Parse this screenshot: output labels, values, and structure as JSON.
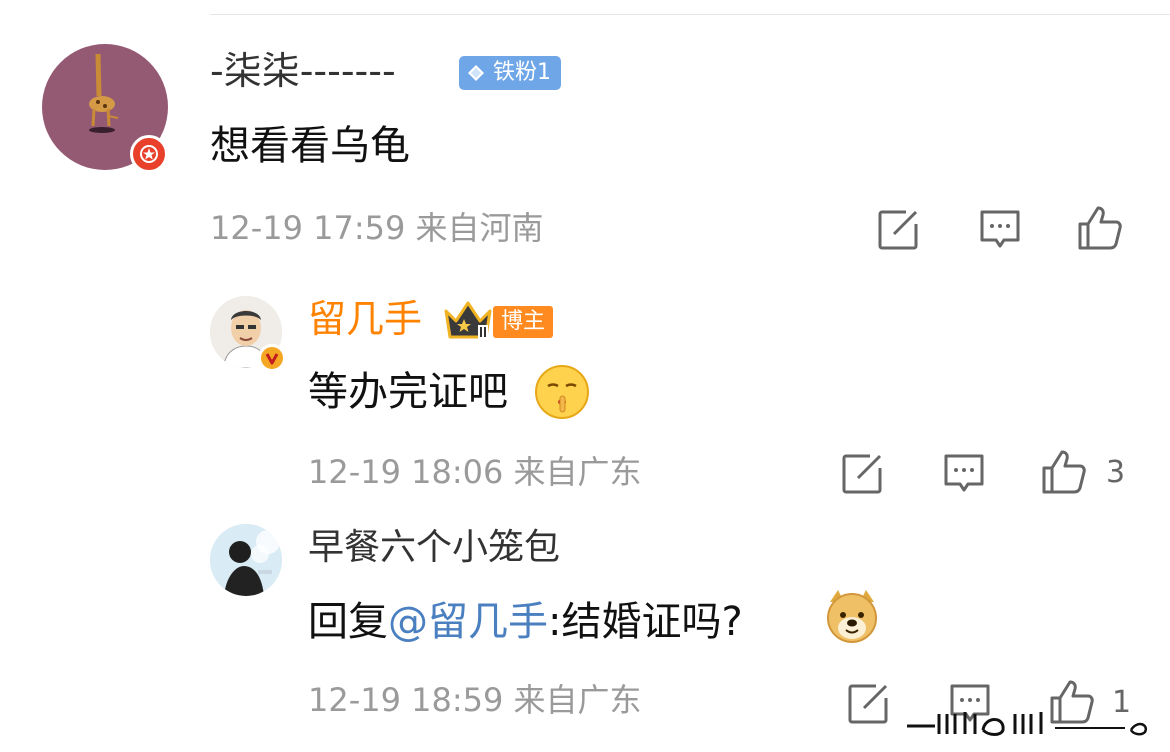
{
  "comments": [
    {
      "username": "-柒柒-------",
      "fan_badge": "铁粉1",
      "text": "想看看乌龟",
      "time": "12-19 17:59",
      "location": "来自河南"
    },
    {
      "username": "留几手",
      "host_tag": "博主",
      "text": "等办完证吧",
      "time": "12-19 18:06",
      "location": "来自广东",
      "likes": "3"
    },
    {
      "username": "早餐六个小笼包",
      "reply_prefix": "回复",
      "mention": "@留几手",
      "text": ":结婚证吗?",
      "time": "12-19 18:59",
      "location": "来自广东",
      "likes": "1"
    }
  ],
  "colors": {
    "host_name": "#ff8200",
    "mention": "#4a7fc0",
    "meta_gray": "#9a9a9a",
    "fan_badge": "#6fa6e8",
    "host_tag": "#ff8a1f"
  },
  "icons": [
    "repost-icon",
    "comment-icon",
    "like-icon",
    "diamond-icon",
    "crown-icon",
    "verified-badge-icon",
    "vip-badge-icon"
  ]
}
